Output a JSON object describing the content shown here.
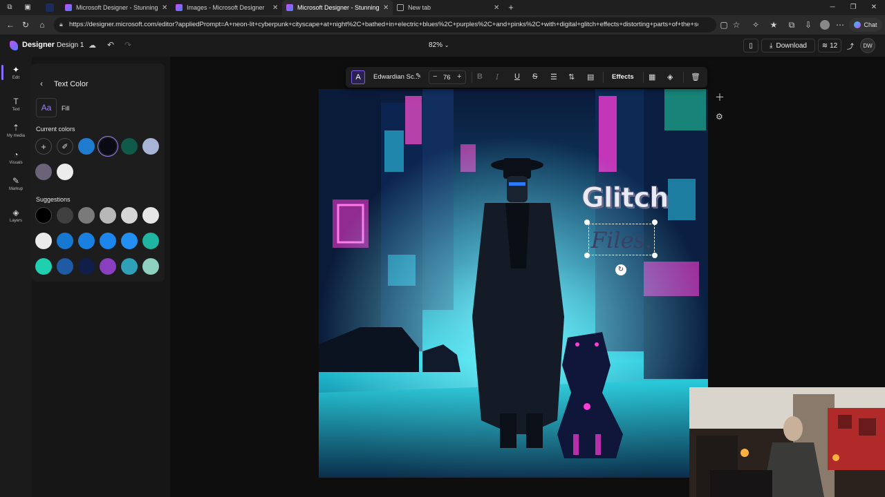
{
  "browser": {
    "tabs": [
      {
        "title": "Microsoft Designer - Stunning de",
        "close": "✕"
      },
      {
        "title": "Images - Microsoft Designer",
        "close": "✕"
      },
      {
        "title": "Microsoft Designer - Stunning de",
        "close": "✕"
      },
      {
        "title": "New tab",
        "close": "✕"
      }
    ],
    "new_tab": "+",
    "url": "https://designer.microsoft.com/editor?appliedPrompt=A+neon-lit+cyberpunk+cityscape+at+night%2C+bathed+in+electric+blues%2C+purples%2C+and+pinks%2C+with+digital+glitch+effects+distorting+parts+of+the+sc...",
    "chat_label": "Chat"
  },
  "app": {
    "brand": "Designer",
    "design_name": "Design 1",
    "zoom": "82%",
    "download_label": "Download",
    "credits": "12",
    "user_initials": "DW"
  },
  "rail": [
    {
      "label": "Edit",
      "icon": "sparkle-icon"
    },
    {
      "label": "Text",
      "icon": "text-icon"
    },
    {
      "label": "My media",
      "icon": "upload-icon"
    },
    {
      "label": "Visuals",
      "icon": "shapes-icon"
    },
    {
      "label": "Markup",
      "icon": "pen-icon"
    },
    {
      "label": "Layers",
      "icon": "layers-icon"
    }
  ],
  "panel": {
    "title": "Text Color",
    "fill_glyph": "Aa",
    "fill_label": "Fill",
    "current_colors_label": "Current colors",
    "suggestions_label": "Suggestions",
    "current_colors": [
      "#1f7bd0",
      "#0a0a14",
      "#0f5a48",
      "#a8b4d6",
      "#6b6478",
      "#ececec"
    ],
    "suggestions": [
      [
        "#000000",
        "#404040",
        "#7a7a7a",
        "#b8b8b8",
        "#d6d6d6",
        "#e6e6e6"
      ],
      [
        "#ececec",
        "#1778d2",
        "#1a7fe0",
        "#1c86ec",
        "#238ff2",
        "#1fb5a0"
      ],
      [
        "#1fd0b0",
        "#1f5aa5",
        "#0f1f48",
        "#8a3fc0",
        "#2ea0b8",
        "#8fd1c0"
      ]
    ]
  },
  "toolbar": {
    "font_glyph": "A",
    "font_name": "Edwardian Sc...",
    "font_size": "76",
    "minus": "−",
    "plus": "+",
    "bold": "B",
    "italic": "I",
    "underline": "U",
    "strike": "S",
    "effects_label": "Effects"
  },
  "canvas": {
    "glitch_text": "Glitch",
    "files_text": "Files."
  }
}
